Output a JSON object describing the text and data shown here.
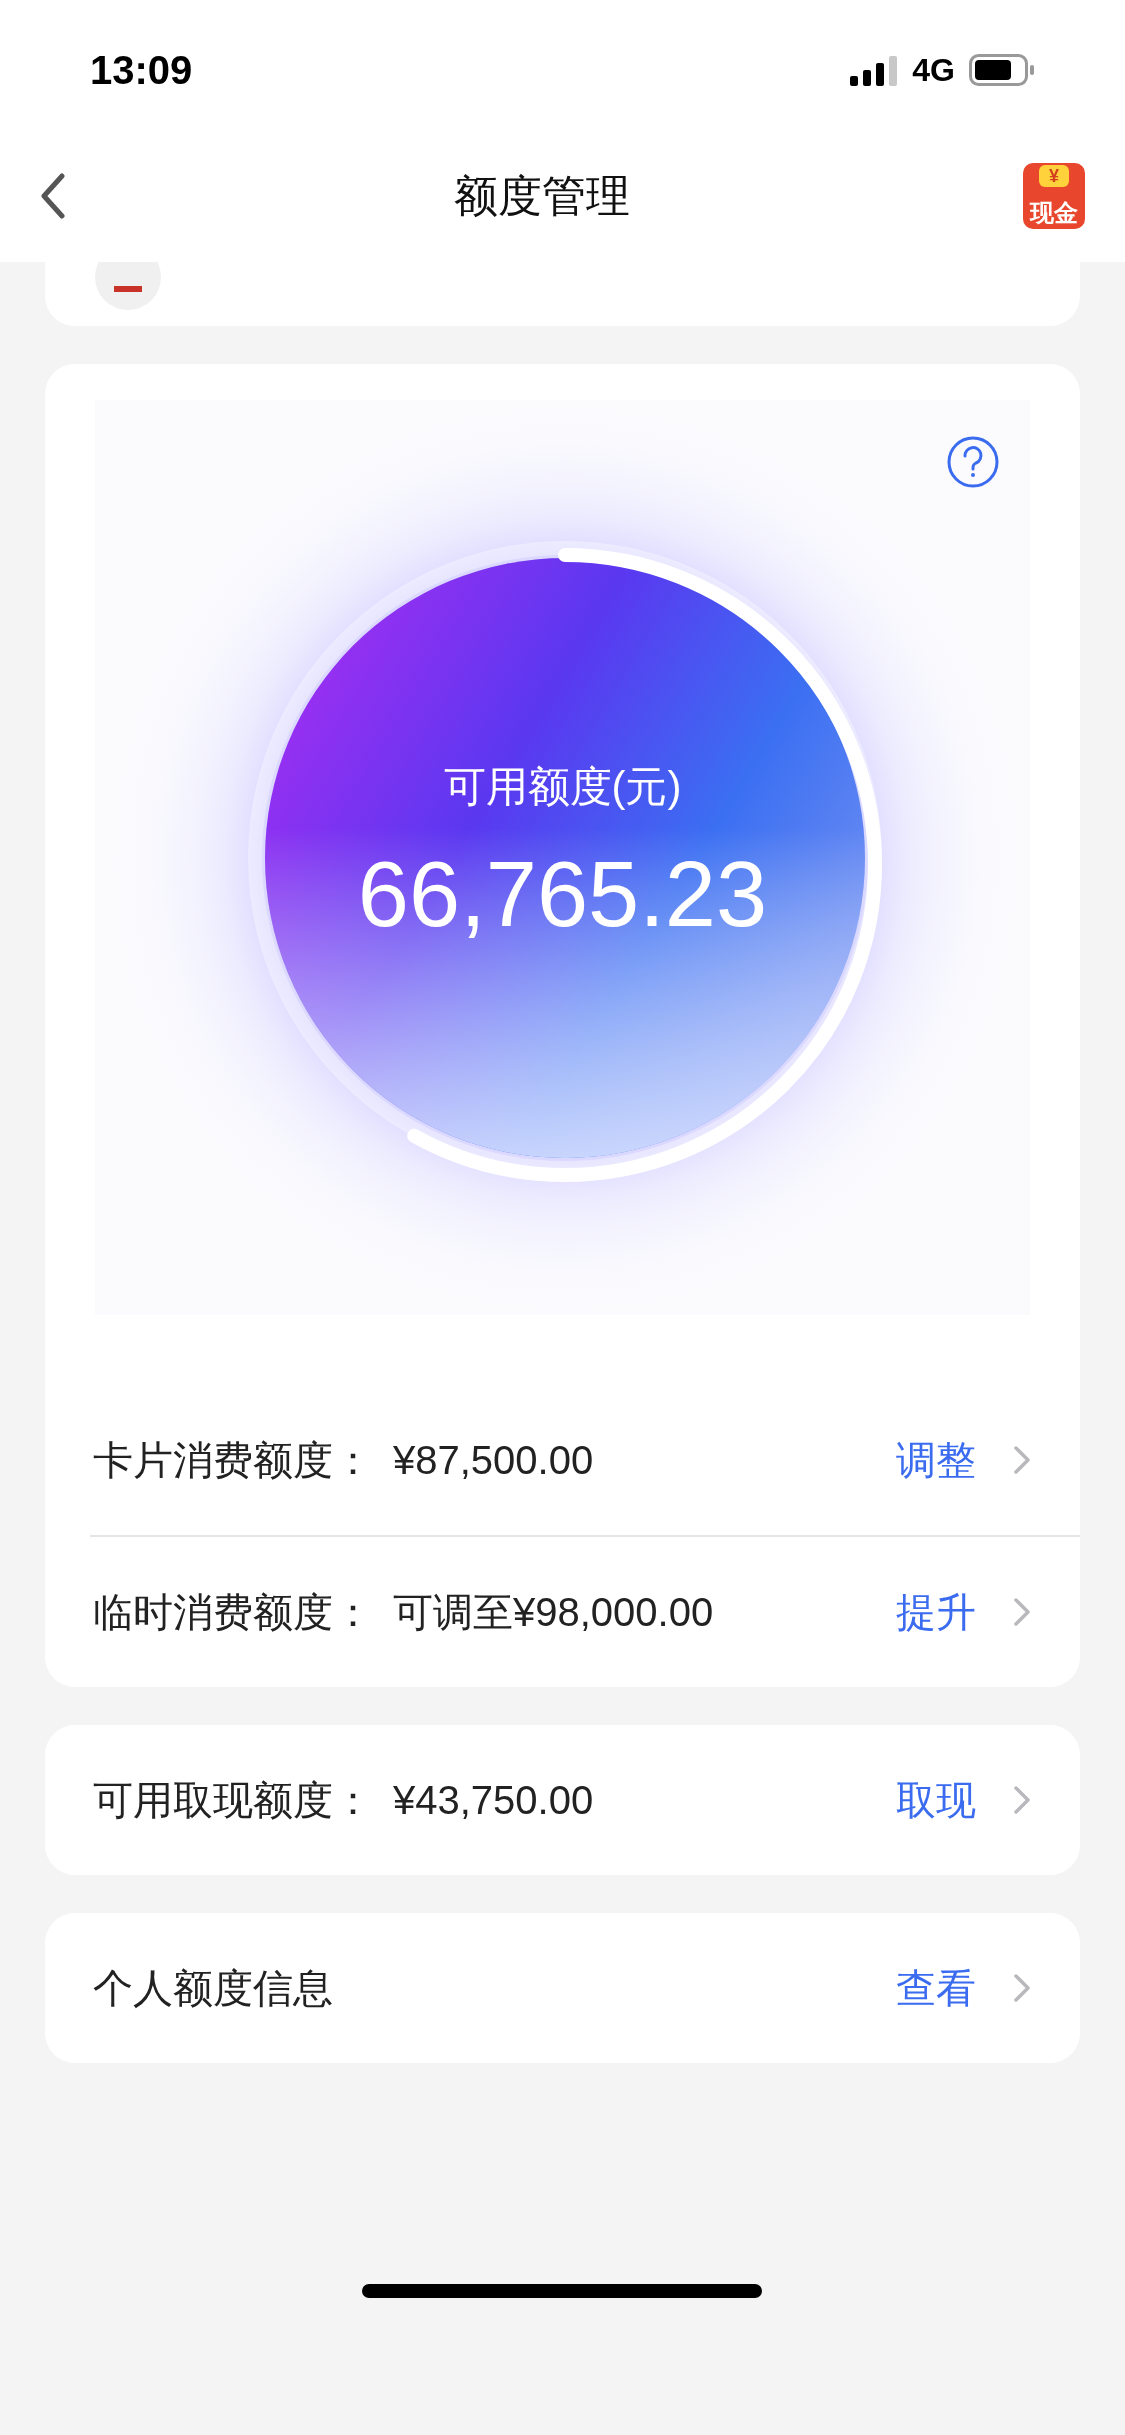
{
  "status_bar": {
    "time": "13:09",
    "network": "4G"
  },
  "header": {
    "title": "额度管理",
    "badge": {
      "symbol": "¥",
      "label": "现金"
    }
  },
  "gauge": {
    "label": "可用额度(元)",
    "amount": "66,765.23"
  },
  "limit_card": [
    {
      "label": "卡片消费额度：",
      "value": "¥87,500.00",
      "action": "调整"
    },
    {
      "label": "临时消费额度：",
      "value": "可调至¥98,000.00",
      "action": "提升"
    }
  ],
  "cards": [
    {
      "label": "可用取现额度：",
      "value": "¥43,750.00",
      "action": "取现"
    },
    {
      "label": "个人额度信息",
      "action": "查看"
    }
  ]
}
